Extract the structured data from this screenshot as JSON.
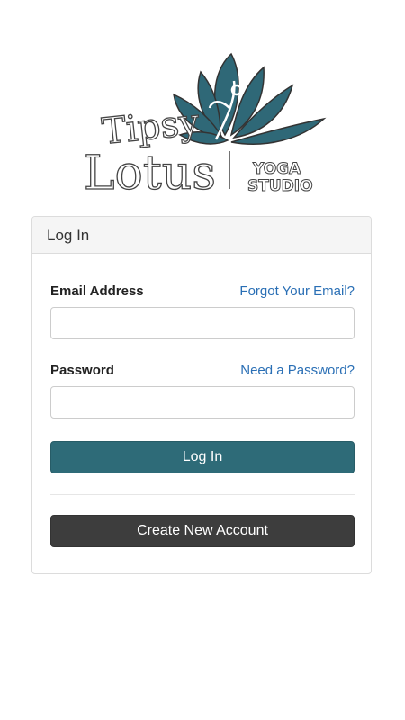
{
  "brand": {
    "logo_word_1": "Tipsy",
    "logo_word_2": "Lotus",
    "logo_tag_1": "YOGA",
    "logo_tag_2": "STUDIO",
    "accent_color": "#2e6b78"
  },
  "login_panel": {
    "title": "Log In",
    "email": {
      "label": "Email Address",
      "link": "Forgot Your Email?",
      "value": "",
      "placeholder": ""
    },
    "password": {
      "label": "Password",
      "link": "Need a Password?",
      "value": "",
      "placeholder": ""
    },
    "login_button": "Log In",
    "create_button": "Create New Account"
  }
}
